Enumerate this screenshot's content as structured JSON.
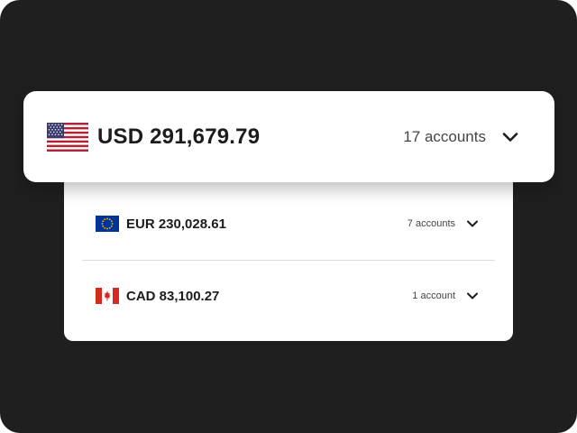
{
  "balances": {
    "main": {
      "currency_flag": "us-flag-icon",
      "amount": "USD 291,679.79",
      "accounts": "17 accounts"
    },
    "items": [
      {
        "currency_flag": "eu-flag-icon",
        "amount": "EUR 230,028.61",
        "accounts": "7 accounts"
      },
      {
        "currency_flag": "ca-flag-icon",
        "amount": "CAD 83,100.27",
        "accounts": "1 account"
      }
    ]
  },
  "colors": {
    "background": "#1f1f1f",
    "card": "#ffffff",
    "text": "#1c1c1c",
    "us_red": "#b22234",
    "us_blue": "#3c3b6e",
    "eu_blue": "#003399",
    "eu_star": "#ffcc00",
    "ca_red": "#d52b1e"
  }
}
